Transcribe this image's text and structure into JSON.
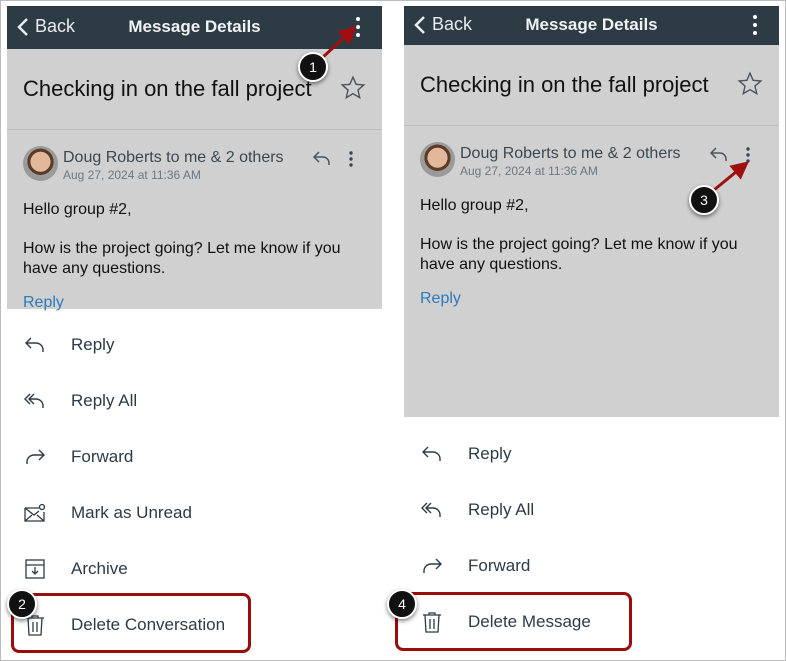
{
  "header": {
    "back_label": "Back",
    "title": "Message Details"
  },
  "message": {
    "subject": "Checking in on the fall project",
    "sender_line": "Doug Roberts to me & 2 others",
    "date": "Aug 27, 2024 at 11:36 AM",
    "greeting": "Hello group #2,",
    "body": "How is the project going? Let me know if you have any questions.",
    "reply_link": "Reply"
  },
  "left_menu": [
    {
      "label": "Reply",
      "icon": "reply-icon"
    },
    {
      "label": "Reply All",
      "icon": "reply-all-icon"
    },
    {
      "label": "Forward",
      "icon": "forward-icon"
    },
    {
      "label": "Mark as Unread",
      "icon": "mark-unread-icon"
    },
    {
      "label": "Archive",
      "icon": "archive-icon"
    },
    {
      "label": "Delete Conversation",
      "icon": "trash-icon"
    }
  ],
  "right_menu": [
    {
      "label": "Reply",
      "icon": "reply-icon"
    },
    {
      "label": "Reply All",
      "icon": "reply-all-icon"
    },
    {
      "label": "Forward",
      "icon": "forward-icon"
    },
    {
      "label": "Delete Message",
      "icon": "trash-icon"
    }
  ],
  "callouts": [
    "1",
    "2",
    "3",
    "4"
  ],
  "colors": {
    "header": "#2d3b45",
    "highlight": "#980c0c",
    "link": "#2b7abc"
  }
}
